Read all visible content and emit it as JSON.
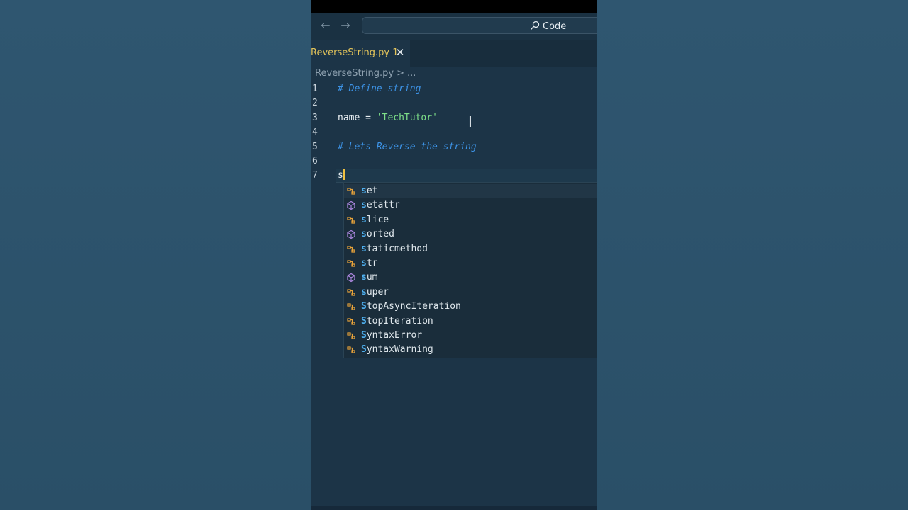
{
  "titlebar": {
    "back_icon": "arrow-left-icon",
    "forward_icon": "arrow-right-icon",
    "search_label": "Code"
  },
  "tab": {
    "label": "ReverseString.py 1",
    "close_glyph": "✕"
  },
  "breadcrumb": {
    "file": "ReverseString.py",
    "separator": ">",
    "more": "..."
  },
  "editor": {
    "lines": [
      {
        "num": "1",
        "comment": "# Define string"
      },
      {
        "num": "2"
      },
      {
        "num": "3",
        "var": "name",
        "op": " = ",
        "str": "'TechTutor'"
      },
      {
        "num": "4"
      },
      {
        "num": "5",
        "comment": "# Lets Reverse the string"
      },
      {
        "num": "6"
      },
      {
        "num": "7",
        "typed": "s"
      }
    ]
  },
  "suggestions": [
    {
      "prefix": "s",
      "rest": "et",
      "icon": "class-icon"
    },
    {
      "prefix": "s",
      "rest": "etattr",
      "icon": "function-cube-icon"
    },
    {
      "prefix": "s",
      "rest": "lice",
      "icon": "class-icon"
    },
    {
      "prefix": "s",
      "rest": "orted",
      "icon": "function-cube-icon"
    },
    {
      "prefix": "s",
      "rest": "taticmethod",
      "icon": "class-icon"
    },
    {
      "prefix": "s",
      "rest": "tr",
      "icon": "class-icon"
    },
    {
      "prefix": "s",
      "rest": "um",
      "icon": "function-cube-icon"
    },
    {
      "prefix": "s",
      "rest": "uper",
      "icon": "class-icon"
    },
    {
      "prefix": "S",
      "rest": "topAsyncIteration",
      "icon": "class-icon"
    },
    {
      "prefix": "S",
      "rest": "topIteration",
      "icon": "class-icon"
    },
    {
      "prefix": "S",
      "rest": "yntaxError",
      "icon": "class-icon"
    },
    {
      "prefix": "S",
      "rest": "yntaxWarning",
      "icon": "class-icon"
    }
  ],
  "colors": {
    "accent_tab": "#e8c14a",
    "comment": "#3d93e6",
    "string": "#7ee089",
    "match_highlight": "#4fb0f0",
    "class_icon": "#e8a33a",
    "function_icon": "#b48ce8"
  }
}
